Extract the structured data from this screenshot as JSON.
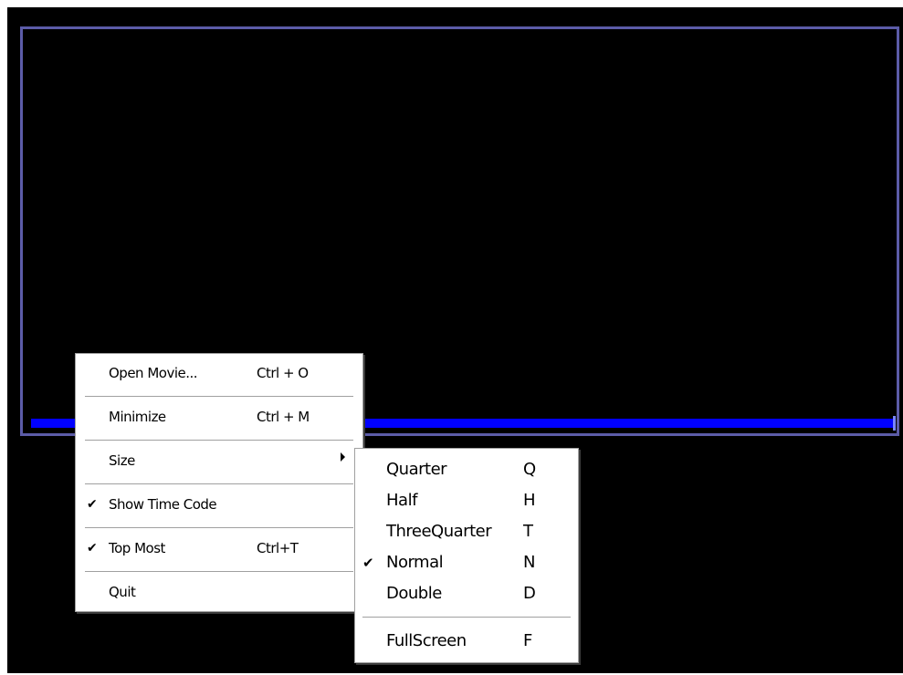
{
  "player": {
    "background": "#000000",
    "frame_color": "#5c5ca8",
    "progress_color": "#0000ff",
    "progress_fraction": 1.0
  },
  "context_menu": {
    "items": [
      {
        "label": "Open Movie...",
        "shortcut": "Ctrl + O",
        "checked": false,
        "submenu": false
      },
      {
        "label": "Minimize",
        "shortcut": "Ctrl + M",
        "checked": false,
        "submenu": false
      },
      {
        "label": "Size",
        "shortcut": "",
        "checked": false,
        "submenu": true
      },
      {
        "label": "Show Time Code",
        "shortcut": "",
        "checked": true,
        "submenu": false
      },
      {
        "label": "Top Most",
        "shortcut": "Ctrl+T",
        "checked": true,
        "submenu": false
      },
      {
        "label": "Quit",
        "shortcut": "",
        "checked": false,
        "submenu": false
      }
    ]
  },
  "size_submenu": {
    "items": [
      {
        "label": "Quarter",
        "shortcut": "Q",
        "checked": false
      },
      {
        "label": "Half",
        "shortcut": "H",
        "checked": false
      },
      {
        "label": "ThreeQuarter",
        "shortcut": "T",
        "checked": false
      },
      {
        "label": "Normal",
        "shortcut": "N",
        "checked": true
      },
      {
        "label": "Double",
        "shortcut": "D",
        "checked": false
      },
      {
        "label": "FullScreen",
        "shortcut": "F",
        "checked": false
      }
    ]
  },
  "icons": {
    "check": "checkmark-icon",
    "submenu_arrow": "submenu-arrow-icon"
  }
}
